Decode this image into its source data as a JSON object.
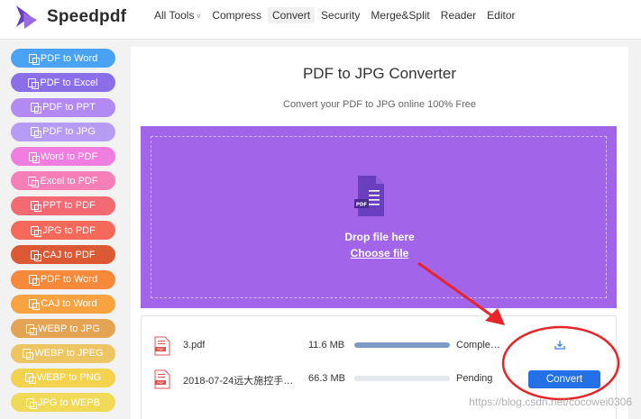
{
  "brand": {
    "name": "Speedpdf"
  },
  "nav": {
    "items": [
      {
        "label": "All Tools",
        "has_caret": true,
        "active": false
      },
      {
        "label": "Compress",
        "has_caret": false,
        "active": false
      },
      {
        "label": "Convert",
        "has_caret": false,
        "active": true
      },
      {
        "label": "Security",
        "has_caret": false,
        "active": false
      },
      {
        "label": "Merge&Split",
        "has_caret": false,
        "active": false
      },
      {
        "label": "Reader",
        "has_caret": false,
        "active": false
      },
      {
        "label": "Editor",
        "has_caret": false,
        "active": false
      }
    ]
  },
  "sidebar": {
    "items": [
      {
        "label": "PDF to Word",
        "color": "#4aa3f2"
      },
      {
        "label": "PDF to Excel",
        "color": "#8a6fe8"
      },
      {
        "label": "PDF to PPT",
        "color": "#b38af4"
      },
      {
        "label": "PDF to JPG",
        "color": "#b79cf6"
      },
      {
        "label": "Word to PDF",
        "color": "#f07ee0"
      },
      {
        "label": "Excel to PDF",
        "color": "#f77fb7"
      },
      {
        "label": "PPT to PDF",
        "color": "#f36a72"
      },
      {
        "label": "JPG to PDF",
        "color": "#f5695a"
      },
      {
        "label": "CAJ to PDF",
        "color": "#dc5a33"
      },
      {
        "label": "PDF to Word",
        "color": "#f7893a"
      },
      {
        "label": "CAJ to Word",
        "color": "#f9a240"
      },
      {
        "label": "WEBP to JPG",
        "color": "#e3a453"
      },
      {
        "label": "WEBP to JPEG",
        "color": "#edc562"
      },
      {
        "label": "WEBP to PNG",
        "color": "#f3d24e"
      },
      {
        "label": "JPG to WEPB",
        "color": "#f1da58"
      }
    ]
  },
  "converter": {
    "title": "PDF to JPG Converter",
    "subtitle": "Convert your PDF to JPG online 100% Free",
    "drop_text": "Drop file here",
    "choose_file": "Choose file",
    "doc_icon_label": "PDF",
    "accent_color": "#a264e8"
  },
  "files": [
    {
      "name": "3.pdf",
      "size": "11.6 MB",
      "progress": 1.0,
      "status": "Comple…",
      "action": "download"
    },
    {
      "name": "2018-07-24远大施控手…",
      "size": "66.3 MB",
      "progress": 0.0,
      "status": "Pending",
      "action": "convert",
      "action_label": "Convert"
    }
  ],
  "file_icon_label": "PDF",
  "watermark": "https://blog.csdn.net/cocowei0306"
}
